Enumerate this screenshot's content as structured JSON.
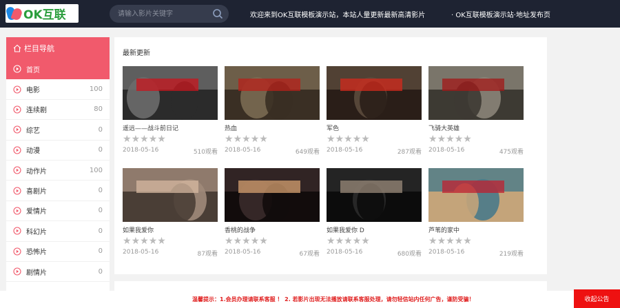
{
  "header": {
    "logo_text": "OK互联",
    "search_placeholder": "请输入影片关键字",
    "notice_1": "欢迎来到OK互联模板演示站，本站人量更新最新高清影片",
    "notice_2": "· OK互联模板演示站·地址发布页"
  },
  "sidebar": {
    "title": "栏目导航",
    "items": [
      {
        "label": "首页",
        "count": "",
        "active": true
      },
      {
        "label": "电影",
        "count": "100"
      },
      {
        "label": "连续剧",
        "count": "80"
      },
      {
        "label": "综艺",
        "count": "0"
      },
      {
        "label": "动漫",
        "count": "0"
      },
      {
        "label": "动作片",
        "count": "100"
      },
      {
        "label": "喜剧片",
        "count": "0"
      },
      {
        "label": "爱情片",
        "count": "0"
      },
      {
        "label": "科幻片",
        "count": "0"
      },
      {
        "label": "恐怖片",
        "count": "0"
      },
      {
        "label": "剧情片",
        "count": "0"
      }
    ]
  },
  "main": {
    "title": "最新更新",
    "movies": [
      {
        "name": "遥远——战斗前日记",
        "date": "2018-05-16",
        "views": "510观看"
      },
      {
        "name": "热血",
        "date": "2018-05-16",
        "views": "649观看"
      },
      {
        "name": "军色",
        "date": "2018-05-16",
        "views": "287观看"
      },
      {
        "name": "飞骑大英雄",
        "date": "2018-05-16",
        "views": "475观看"
      },
      {
        "name": "如果我爱你",
        "date": "2018-05-16",
        "views": "87观看"
      },
      {
        "name": "香桃的战争",
        "date": "2018-05-16",
        "views": "67观看"
      },
      {
        "name": "如果我爱你 D",
        "date": "2018-05-16",
        "views": "680观看"
      },
      {
        "name": "芦苇的家中",
        "date": "2018-05-16",
        "views": "219观看"
      }
    ]
  },
  "footer": {
    "text": "温馨提示：1.会员办理请联系客服 ！ 2. 若影片出现无法播放请联系客服处理，请勿轻信站内任何广告，谨防受骗！",
    "button": "收起公告"
  },
  "colors": {
    "accent": "#f15a6c",
    "header_bg": "#1e2332",
    "footer_red": "#ee1111"
  }
}
